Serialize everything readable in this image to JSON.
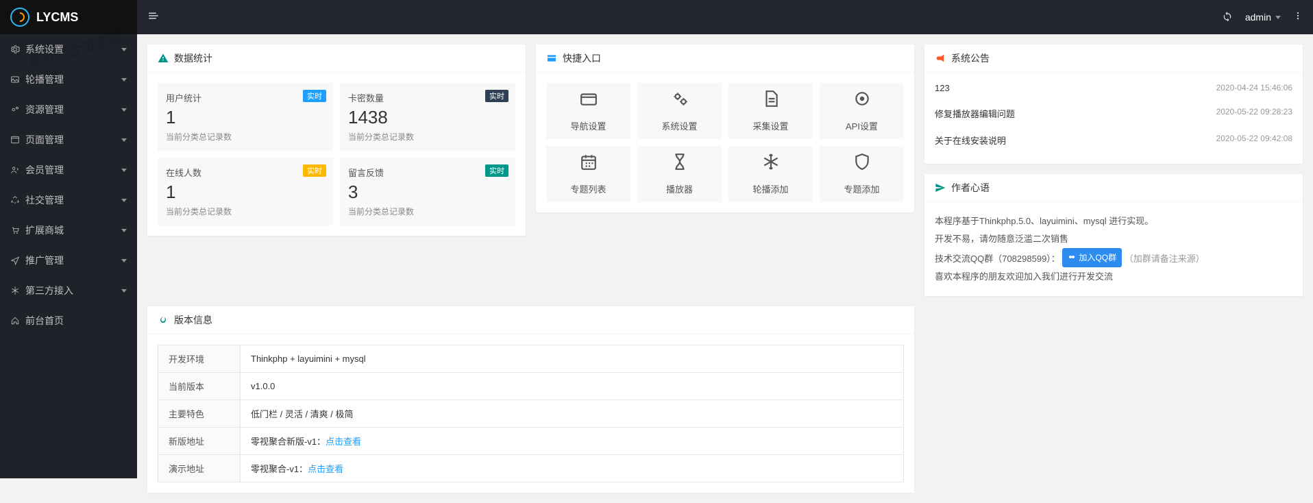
{
  "brand": "LYCMS",
  "watermark": {
    "line1": "全都有综合资源网",
    "line2": "duyouvip.com"
  },
  "topbar": {
    "user": "admin"
  },
  "sidebar": {
    "items": [
      {
        "label": "系统设置",
        "icon": "gear-icon"
      },
      {
        "label": "轮播管理",
        "icon": "images-icon"
      },
      {
        "label": "资源管理",
        "icon": "gears-icon"
      },
      {
        "label": "页面管理",
        "icon": "window-icon"
      },
      {
        "label": "会员管理",
        "icon": "users-icon"
      },
      {
        "label": "社交管理",
        "icon": "recycle-icon"
      },
      {
        "label": "扩展商城",
        "icon": "cart-icon"
      },
      {
        "label": "推广管理",
        "icon": "send-icon"
      },
      {
        "label": "第三方接入",
        "icon": "snow-icon"
      },
      {
        "label": "前台首页",
        "icon": "home-icon"
      }
    ]
  },
  "stats": {
    "title": "数据统计",
    "badge_label": "实时",
    "items": [
      {
        "title": "用户统计",
        "value": "1",
        "sub": "当前分类总记录数",
        "badge": "blue"
      },
      {
        "title": "卡密数量",
        "value": "1438",
        "sub": "当前分类总记录数",
        "badge": "dark"
      },
      {
        "title": "在线人数",
        "value": "1",
        "sub": "当前分类总记录数",
        "badge": "orange"
      },
      {
        "title": "留言反馈",
        "value": "3",
        "sub": "当前分类总记录数",
        "badge": "green"
      }
    ]
  },
  "quick": {
    "title": "快捷入口",
    "items": [
      {
        "label": "导航设置",
        "icon": "card"
      },
      {
        "label": "系统设置",
        "icon": "gears"
      },
      {
        "label": "采集设置",
        "icon": "file"
      },
      {
        "label": "API设置",
        "icon": "target"
      },
      {
        "label": "专题列表",
        "icon": "calendar"
      },
      {
        "label": "播放器",
        "icon": "hourglass"
      },
      {
        "label": "轮播添加",
        "icon": "snowflake"
      },
      {
        "label": "专题添加",
        "icon": "shield"
      }
    ]
  },
  "notice": {
    "title": "系统公告",
    "items": [
      {
        "title": "123",
        "time": "2020-04-24 15:46:06"
      },
      {
        "title": "修复播放器编辑问题",
        "time": "2020-05-22 09:28:23"
      },
      {
        "title": "关于在线安装说明",
        "time": "2020-05-22 09:42:08"
      }
    ]
  },
  "author": {
    "title": "作者心语",
    "line1": "本程序基于Thinkphp.5.0、layuimini、mysql 进行实现。",
    "line2": "开发不易，请勿随意泛滥二次销售",
    "line3_prefix": "技术交流QQ群（708298599）：",
    "qq_btn": "加入QQ群",
    "line3_suffix": "（加群请备注来源）",
    "line4": "喜欢本程序的朋友欢迎加入我们进行开发交流"
  },
  "version": {
    "title": "版本信息",
    "link_text": "点击查看",
    "rows": [
      {
        "k": "开发环境",
        "v": "Thinkphp + layuimini + mysql"
      },
      {
        "k": "当前版本",
        "v": "v1.0.0"
      },
      {
        "k": "主要特色",
        "v": "低门栏 / 灵活 / 清爽 / 极简"
      },
      {
        "k": "新版地址",
        "v": "零视聚合新版-v1：",
        "link": true
      },
      {
        "k": "演示地址",
        "v": "零视聚合-v1：",
        "link": true
      }
    ]
  }
}
